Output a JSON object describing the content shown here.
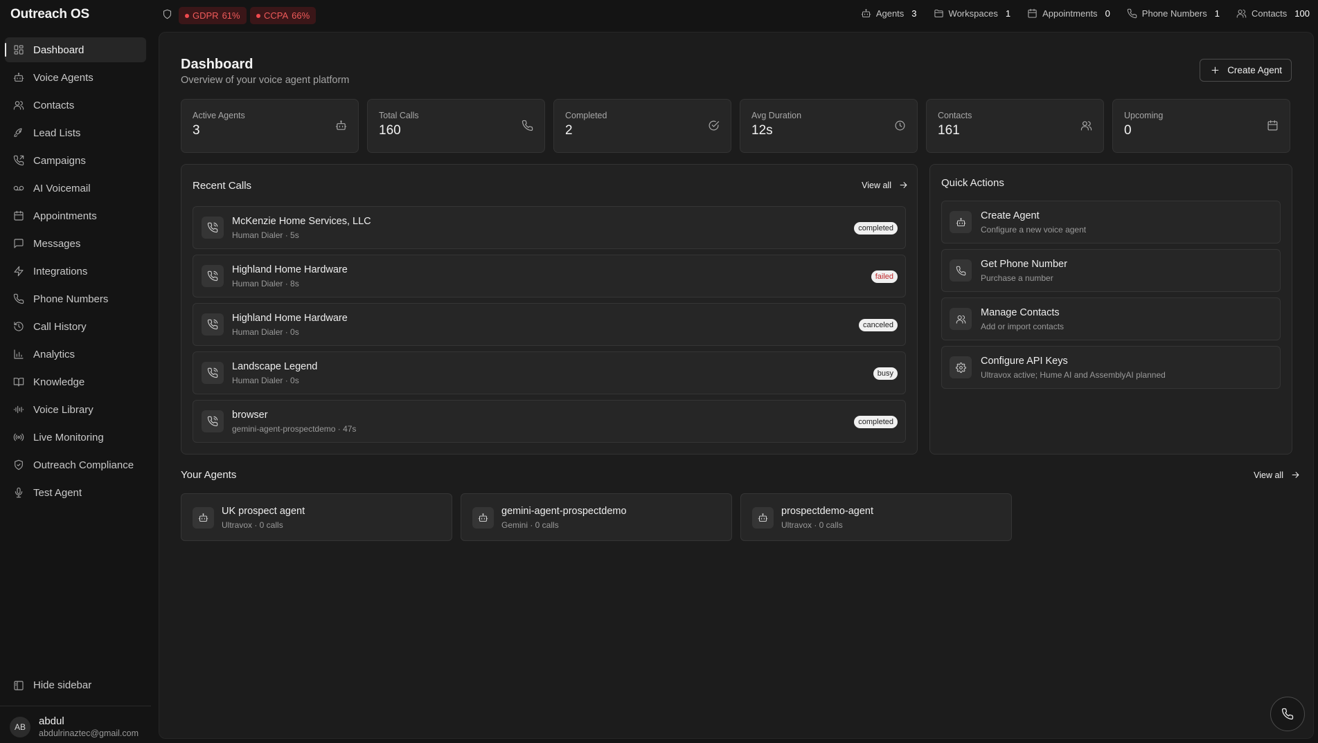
{
  "app": {
    "title": "Outreach OS"
  },
  "compliance": [
    {
      "label": "GDPR",
      "value": "61%"
    },
    {
      "label": "CCPA",
      "value": "66%"
    }
  ],
  "top_stats": [
    {
      "label": "Agents",
      "value": "3",
      "icon": "bot-icon"
    },
    {
      "label": "Workspaces",
      "value": "1",
      "icon": "folder-icon"
    },
    {
      "label": "Appointments",
      "value": "0",
      "icon": "calendar-icon"
    },
    {
      "label": "Phone Numbers",
      "value": "1",
      "icon": "phone-icon"
    },
    {
      "label": "Contacts",
      "value": "100",
      "icon": "users-icon"
    }
  ],
  "sidebar": {
    "items": [
      {
        "label": "Dashboard",
        "icon": "grid-icon",
        "active": true
      },
      {
        "label": "Voice Agents",
        "icon": "bot-icon"
      },
      {
        "label": "Contacts",
        "icon": "users-icon"
      },
      {
        "label": "Lead Lists",
        "icon": "rocket-icon"
      },
      {
        "label": "Campaigns",
        "icon": "phone-outgoing-icon"
      },
      {
        "label": "AI Voicemail",
        "icon": "voicemail-icon"
      },
      {
        "label": "Appointments",
        "icon": "calendar-icon"
      },
      {
        "label": "Messages",
        "icon": "message-icon"
      },
      {
        "label": "Integrations",
        "icon": "bolt-icon"
      },
      {
        "label": "Phone Numbers",
        "icon": "phone-icon"
      },
      {
        "label": "Call History",
        "icon": "history-icon"
      },
      {
        "label": "Analytics",
        "icon": "bar-chart-icon"
      },
      {
        "label": "Knowledge",
        "icon": "book-icon"
      },
      {
        "label": "Voice Library",
        "icon": "waveform-icon"
      },
      {
        "label": "Live Monitoring",
        "icon": "broadcast-icon"
      },
      {
        "label": "Outreach Compliance",
        "icon": "shield-check-icon"
      },
      {
        "label": "Test Agent",
        "icon": "mic-icon"
      }
    ],
    "hide_label": "Hide sidebar",
    "user": {
      "initials": "AB",
      "name": "abdul",
      "email": "abdulrinaztec@gmail.com"
    }
  },
  "page": {
    "title": "Dashboard",
    "subtitle": "Overview of your voice agent platform",
    "create_button": "Create Agent"
  },
  "cards": [
    {
      "label": "Active Agents",
      "value": "3",
      "icon": "bot-icon"
    },
    {
      "label": "Total Calls",
      "value": "160",
      "icon": "phone-icon"
    },
    {
      "label": "Completed",
      "value": "2",
      "icon": "check-circle-icon"
    },
    {
      "label": "Avg Duration",
      "value": "12s",
      "icon": "clock-icon"
    },
    {
      "label": "Contacts",
      "value": "161",
      "icon": "users-icon"
    },
    {
      "label": "Upcoming",
      "value": "0",
      "icon": "calendar-icon"
    }
  ],
  "recent_calls": {
    "title": "Recent Calls",
    "view_all": "View all",
    "items": [
      {
        "name": "McKenzie Home Services, LLC",
        "meta": "Human Dialer · 5s",
        "status": "completed"
      },
      {
        "name": "Highland Home Hardware",
        "meta": "Human Dialer · 8s",
        "status": "failed"
      },
      {
        "name": "Highland Home Hardware",
        "meta": "Human Dialer · 0s",
        "status": "canceled"
      },
      {
        "name": "Landscape Legend",
        "meta": "Human Dialer · 0s",
        "status": "busy"
      },
      {
        "name": "browser",
        "meta": "gemini-agent-prospectdemo · 47s",
        "status": "completed"
      }
    ]
  },
  "quick_actions": {
    "title": "Quick Actions",
    "items": [
      {
        "name": "Create Agent",
        "desc": "Configure a new voice agent",
        "icon": "bot-icon"
      },
      {
        "name": "Get Phone Number",
        "desc": "Purchase a number",
        "icon": "phone-icon"
      },
      {
        "name": "Manage Contacts",
        "desc": "Add or import contacts",
        "icon": "users-icon"
      },
      {
        "name": "Configure API Keys",
        "desc": "Ultravox active; Hume AI and AssemblyAI planned",
        "icon": "gear-icon"
      }
    ]
  },
  "agents": {
    "title": "Your Agents",
    "view_all": "View all",
    "items": [
      {
        "name": "UK prospect agent",
        "meta": "Ultravox · 0 calls"
      },
      {
        "name": "gemini-agent-prospectdemo",
        "meta": "Gemini · 0 calls"
      },
      {
        "name": "prospectdemo-agent",
        "meta": "Ultravox · 0 calls"
      }
    ]
  },
  "colors": {
    "accent_red": "#f05a5a",
    "background": "#141414",
    "panel": "#1c1c1c"
  }
}
